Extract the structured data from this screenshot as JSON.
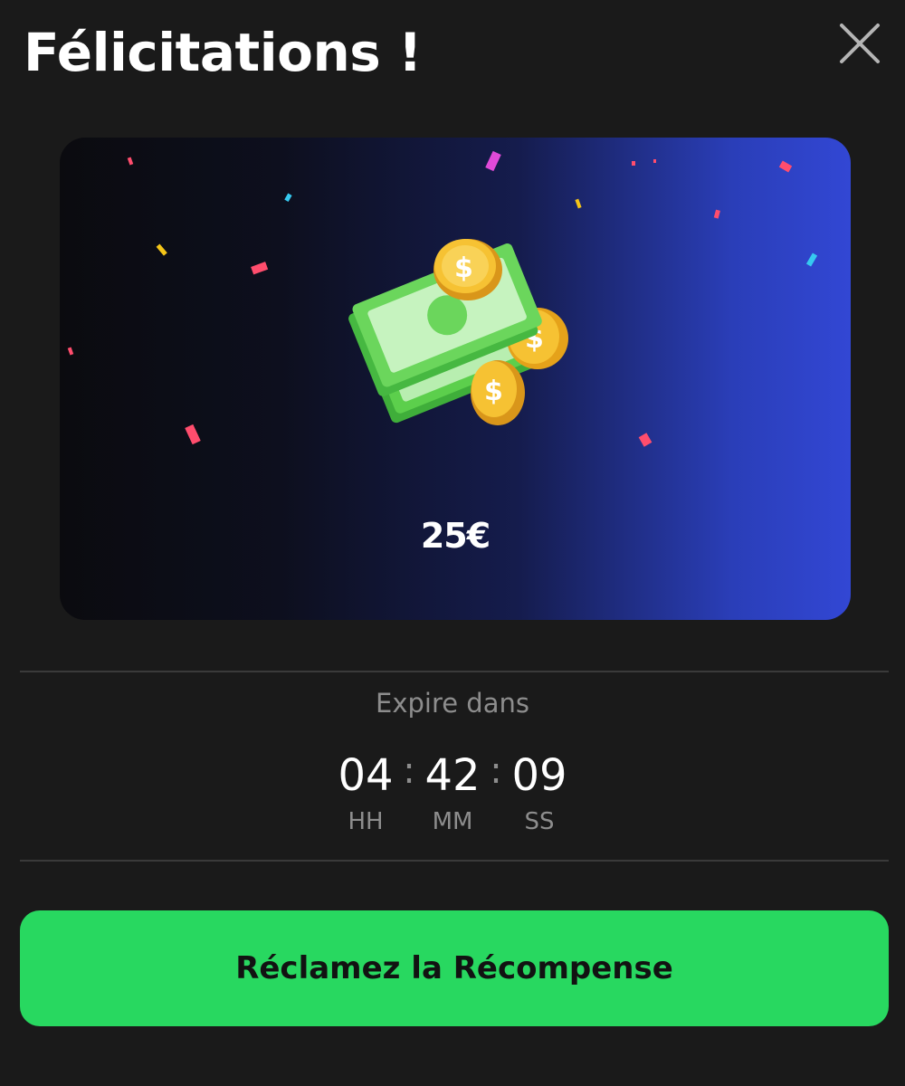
{
  "dialog": {
    "title": "Félicitations !",
    "close_icon": "close-icon"
  },
  "reward": {
    "amount": "25€",
    "illustration": "money-bills-and-coins-illustration",
    "colors": {
      "card_gradient_start": "#0b0b0f",
      "card_gradient_end": "#3247d4"
    }
  },
  "expiry": {
    "label": "Expire dans",
    "hours": "04",
    "minutes": "42",
    "seconds": "09",
    "hours_label": "HH",
    "minutes_label": "MM",
    "seconds_label": "SS",
    "separator": ":"
  },
  "cta": {
    "label": "Réclamez la Récompense",
    "color": "#28d860"
  }
}
